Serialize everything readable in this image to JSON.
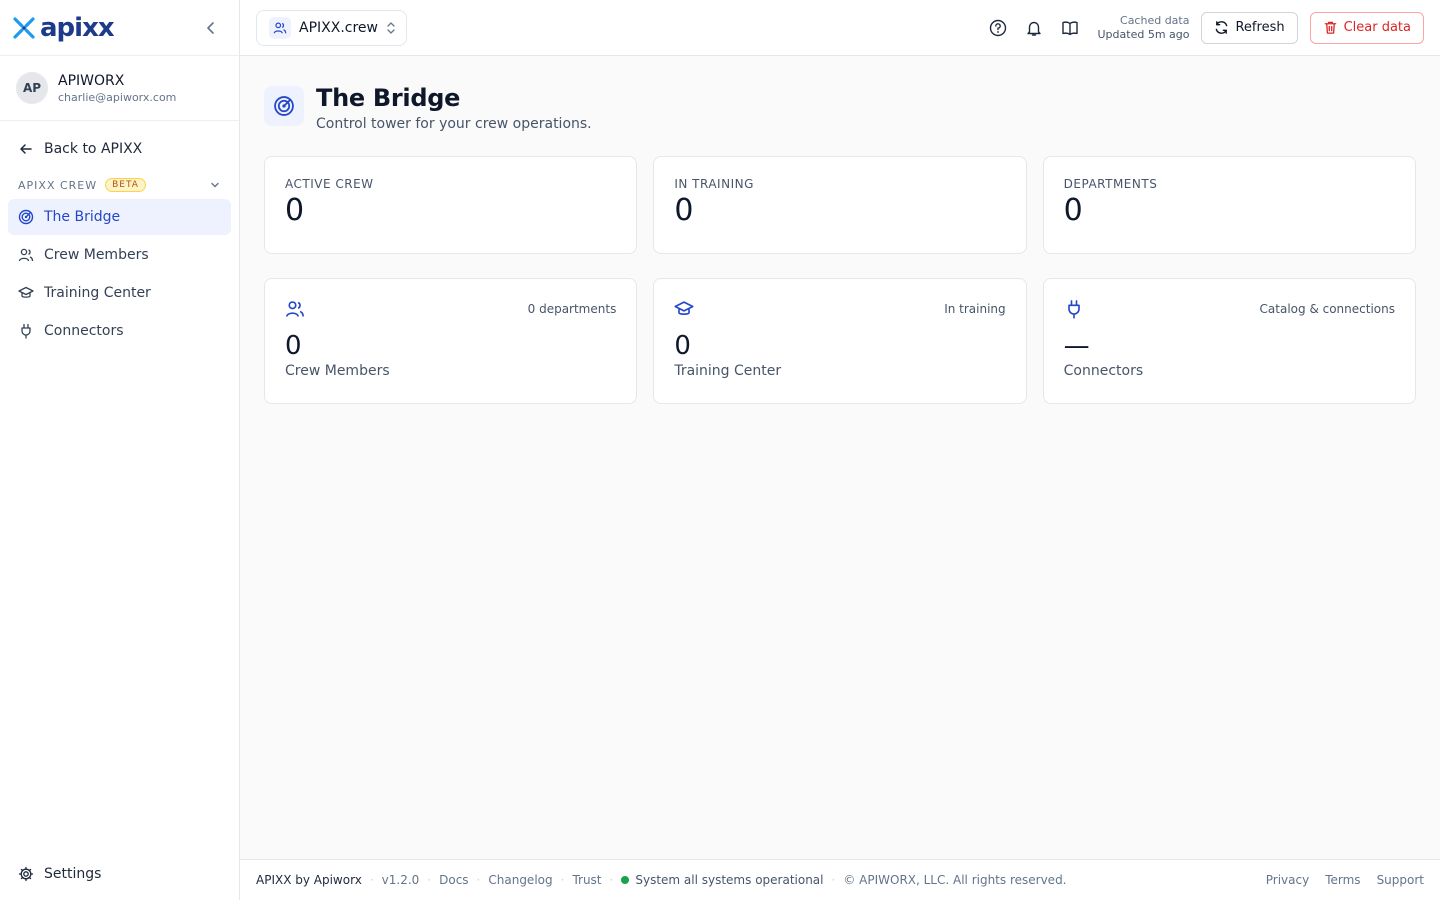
{
  "brand": {
    "logo_text": "apixx",
    "logo_color": "#1e3a8a"
  },
  "user": {
    "initials": "AP",
    "name": "APIWORX",
    "email": "charlie@apiworx.com"
  },
  "sidebar": {
    "back_label": "Back to APIXX",
    "section_label": "APIXX CREW",
    "section_badge": "BETA",
    "items": [
      {
        "label": "The Bridge",
        "icon": "radar-icon",
        "active": true
      },
      {
        "label": "Crew Members",
        "icon": "users-icon"
      },
      {
        "label": "Training Center",
        "icon": "graduation-cap-icon"
      },
      {
        "label": "Connectors",
        "icon": "plug-icon"
      }
    ],
    "settings_label": "Settings"
  },
  "topbar": {
    "app_switcher_label": "APIXX.crew",
    "cache_line1": "Cached data",
    "cache_line2": "Updated 5m ago",
    "refresh_label": "Refresh",
    "clear_label": "Clear data"
  },
  "page": {
    "title": "The Bridge",
    "subtitle": "Control tower for your crew operations."
  },
  "stats": [
    {
      "label": "ACTIVE CREW",
      "value": "0"
    },
    {
      "label": "IN TRAINING",
      "value": "0"
    },
    {
      "label": "DEPARTMENTS",
      "value": "0"
    }
  ],
  "cards": [
    {
      "hint": "0 departments",
      "value": "0",
      "name": "Crew Members",
      "icon": "users-icon"
    },
    {
      "hint": "In training",
      "value": "0",
      "name": "Training Center",
      "icon": "graduation-cap-icon"
    },
    {
      "hint": "Catalog & connections",
      "value": "—",
      "name": "Connectors",
      "icon": "plug-icon"
    }
  ],
  "footer": {
    "brand": "APIXX by Apiworx",
    "version": "v1.2.0",
    "docs": "Docs",
    "changelog": "Changelog",
    "trust": "Trust",
    "status": "System all systems operational",
    "copyright": "© APIWORX, LLC. All rights reserved.",
    "privacy": "Privacy",
    "terms": "Terms",
    "support": "Support"
  },
  "colors": {
    "accent": "#2447c9",
    "danger": "#dc2626",
    "status_ok": "#16a34a"
  }
}
